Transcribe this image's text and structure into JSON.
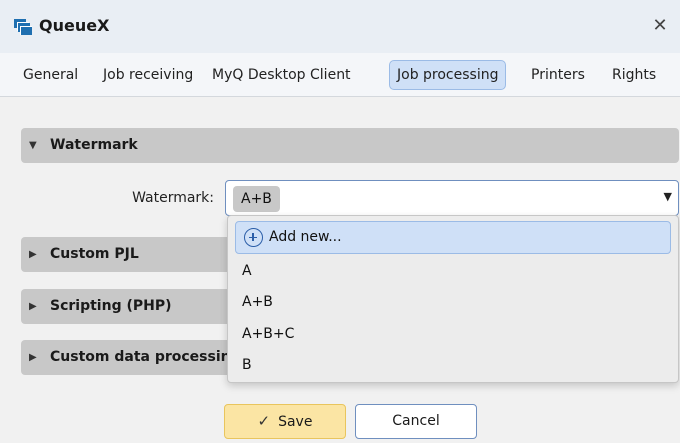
{
  "window": {
    "title": "QueueX",
    "close": "✕"
  },
  "tabs": [
    {
      "label": "General"
    },
    {
      "label": "Job receiving"
    },
    {
      "label": "MyQ Desktop Client"
    },
    {
      "label": "Job processing",
      "active": true
    },
    {
      "label": "Printers"
    },
    {
      "label": "Rights"
    }
  ],
  "sections": [
    {
      "label": "Watermark",
      "expanded": true,
      "chevron": "▼"
    },
    {
      "label": "Custom PJL",
      "expanded": false,
      "chevron": "▶"
    },
    {
      "label": "Scripting (PHP)",
      "expanded": false,
      "chevron": "▶"
    },
    {
      "label": "Custom data processing",
      "expanded": false,
      "chevron": "▶"
    }
  ],
  "watermark": {
    "label": "Watermark:",
    "selected": "A+B",
    "arrow": "▼",
    "dropdown": {
      "add_new": "Add new...",
      "options": [
        "A",
        "A+B",
        "A+B+C",
        "B"
      ]
    }
  },
  "footer": {
    "save_label": "Save",
    "save_icon": "✓",
    "cancel_label": "Cancel"
  },
  "colors": {
    "accent_tab": "#cfe0f7",
    "save_button": "#fbe5a4",
    "section_header": "#c8c8c8",
    "app_icon": "#1f6fb0"
  }
}
